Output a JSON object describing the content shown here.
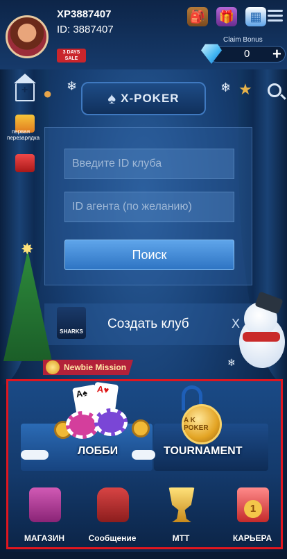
{
  "header": {
    "username": "XP3887407",
    "user_id": "ID: 3887407",
    "sale_badge": "3 DAYS SALE",
    "claim_bonus_label": "Claim Bonus",
    "diamond_count": "0",
    "plus": "+"
  },
  "logo": {
    "text": "X-POKER"
  },
  "promo": {
    "first_topup": "первая перезарядка"
  },
  "join_form": {
    "club_id_placeholder": "Введите ID клуба",
    "agent_id_placeholder": "ID агента (по желанию)",
    "search_label": "Поиск"
  },
  "create_club": {
    "logo_text": "SHARKS",
    "label": "Создать клуб",
    "close": "X"
  },
  "mission": {
    "label": "Newbie Mission"
  },
  "tiles": {
    "lobby": "ЛОББИ",
    "tournament": "TOURNAMENT",
    "medal_text": "A K POKER"
  },
  "bottom_nav": [
    {
      "label": "МАГАЗИН",
      "icon": "shop-icon"
    },
    {
      "label": "Сообщение",
      "icon": "mailbox-icon"
    },
    {
      "label": "МТТ",
      "icon": "trophy-icon"
    },
    {
      "label": "КАРЬЕРА",
      "icon": "career-medal-icon"
    }
  ],
  "colors": {
    "accent_blue": "#2e74c3",
    "highlight_red": "#e0161f",
    "background": "#0e2a52"
  }
}
